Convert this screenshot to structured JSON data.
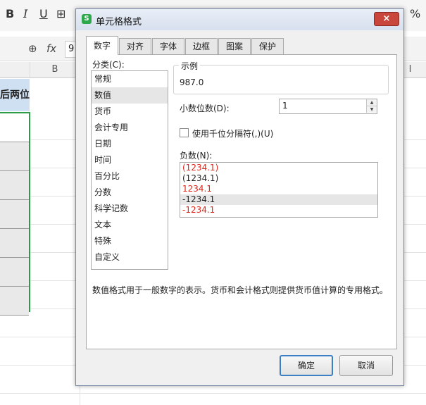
{
  "toolbar": {
    "bold": "B",
    "italic": "I",
    "underline": "U",
    "border": "⊞",
    "percent": "%"
  },
  "formula_bar": {
    "zoom_icon": "zoom-icon",
    "fx": "fx",
    "namebox": "9"
  },
  "sheet": {
    "col_b": "B",
    "col_i": "I",
    "header_text": "后两位"
  },
  "dialog": {
    "title": "单元格格式",
    "app_icon": "S",
    "close_symbol": "×",
    "tabs": [
      "数字",
      "对齐",
      "字体",
      "边框",
      "图案",
      "保护"
    ],
    "category_label": "分类(C):",
    "categories": [
      "常规",
      "数值",
      "货币",
      "会计专用",
      "日期",
      "时间",
      "百分比",
      "分数",
      "科学记数",
      "文本",
      "特殊",
      "自定义"
    ],
    "selected_category": "数值",
    "sample_label": "示例",
    "sample_value": "987.0",
    "decimal_label": "小数位数(D):",
    "decimal_value": "1",
    "thousand_sep_label": "使用千位分隔符(,)(U)",
    "thousand_sep_checked": false,
    "negative_label": "负数(N):",
    "negative_options": [
      {
        "text": "(1234.1)",
        "color": "#e0251b"
      },
      {
        "text": "(1234.1)",
        "color": "#222222"
      },
      {
        "text": "1234.1",
        "color": "#e0251b"
      },
      {
        "text": "-1234.1",
        "color": "#222222",
        "selected": true
      },
      {
        "text": "-1234.1",
        "color": "#e0251b"
      }
    ],
    "description": "数值格式用于一般数字的表示。货币和会计格式则提供货币值计算的专用格式。",
    "ok_label": "确定",
    "cancel_label": "取消"
  }
}
